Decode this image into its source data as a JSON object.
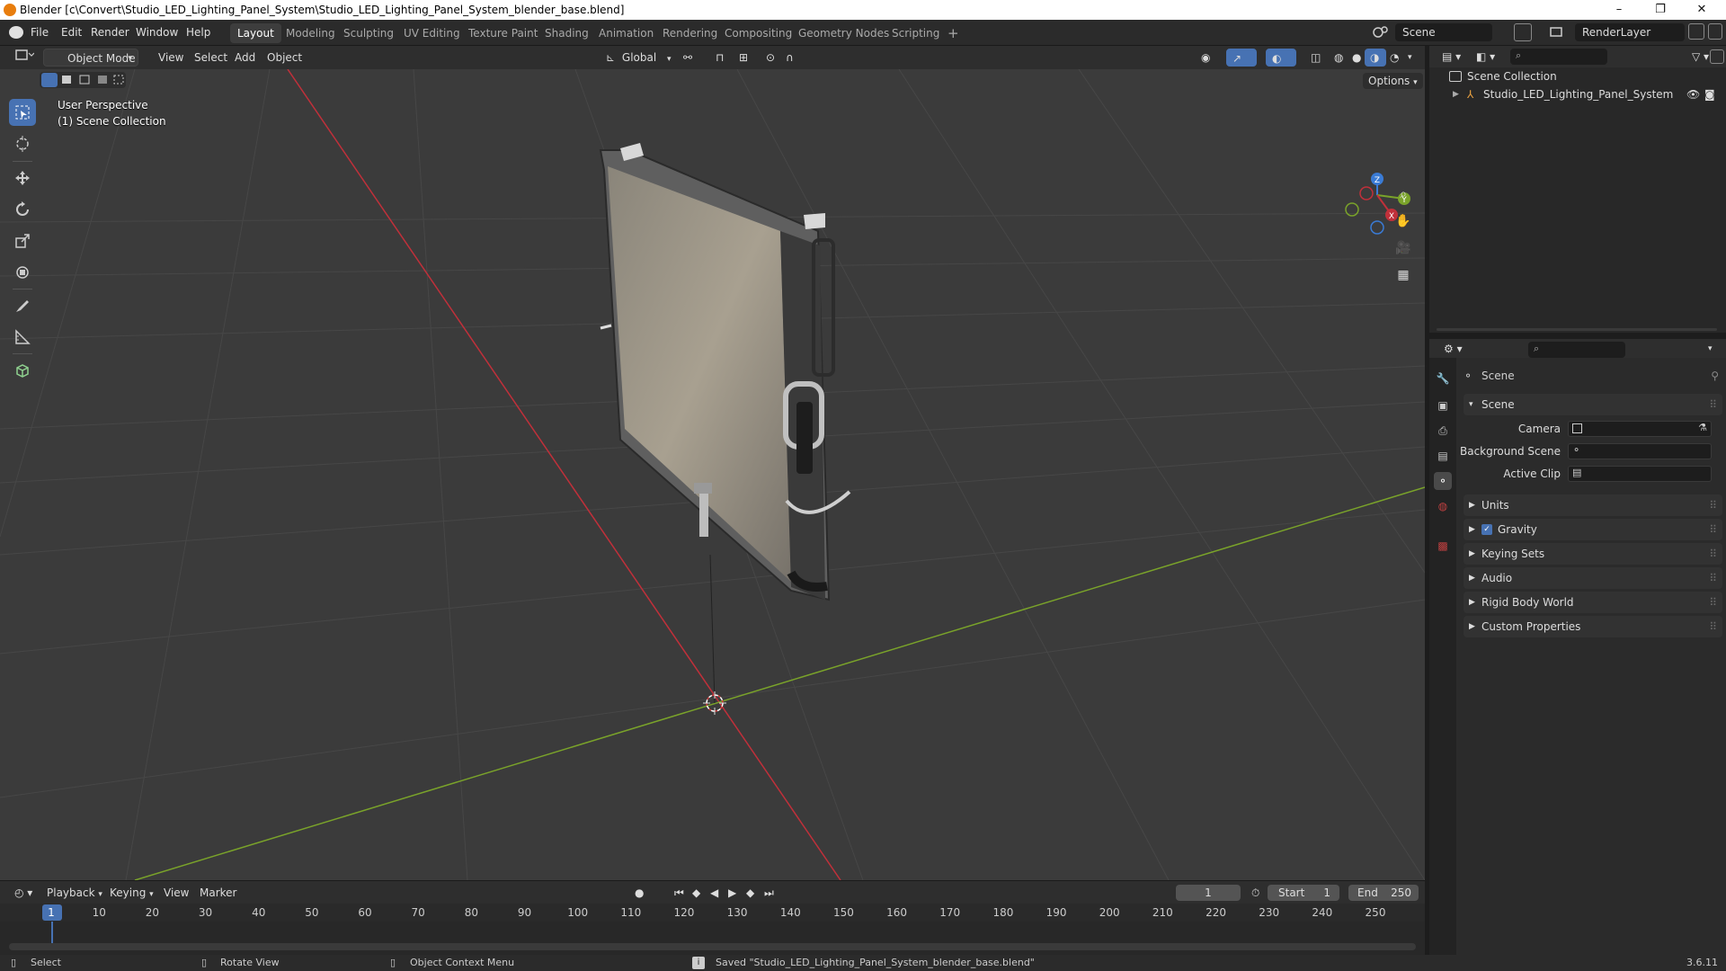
{
  "window": {
    "title": "Blender [c\\Convert\\Studio_LED_Lighting_Panel_System\\Studio_LED_Lighting_Panel_System_blender_base.blend]",
    "minimize": "–",
    "maximize": "❐",
    "close": "✕"
  },
  "menu": {
    "items": [
      "File",
      "Edit",
      "Render",
      "Window",
      "Help"
    ]
  },
  "workspaces": {
    "tabs": [
      "Layout",
      "Modeling",
      "Sculpting",
      "UV Editing",
      "Texture Paint",
      "Shading",
      "Animation",
      "Rendering",
      "Compositing",
      "Geometry Nodes",
      "Scripting"
    ],
    "add": "+",
    "active": "Layout"
  },
  "scene_selector": {
    "scene": "Scene",
    "view_layer": "RenderLayer"
  },
  "viewport_header": {
    "mode": "Object Mode",
    "menus": [
      "View",
      "Select",
      "Add",
      "Object"
    ],
    "transform_orientation": "Global",
    "options": "Options"
  },
  "viewport": {
    "perspective": "User Perspective",
    "collection": "(1) Scene Collection",
    "axis_colors": {
      "x": "#c0303a",
      "y": "#7aa32a",
      "z": "#3a7bd5"
    },
    "gizmo": {
      "x": "X",
      "y": "Y",
      "z": "Z"
    }
  },
  "toolbar": {
    "tools": [
      "select-box-icon",
      "cursor-icon",
      "move-icon",
      "rotate-icon",
      "scale-icon",
      "transform-icon",
      "annotate-icon",
      "measure-icon",
      "add-cube-icon"
    ]
  },
  "timeline": {
    "menus": [
      "Playback",
      "Keying",
      "View",
      "Marker"
    ],
    "current_frame": "1",
    "start_label": "Start",
    "start": "1",
    "end_label": "End",
    "end": "250",
    "ticks": [
      "1",
      "10",
      "20",
      "30",
      "40",
      "50",
      "60",
      "70",
      "80",
      "90",
      "100",
      "110",
      "120",
      "130",
      "140",
      "150",
      "160",
      "170",
      "180",
      "190",
      "200",
      "210",
      "220",
      "230",
      "240",
      "250"
    ]
  },
  "statusbar": {
    "select": "Select",
    "rotate": "Rotate View",
    "context": "Object Context Menu",
    "message": "Saved \"Studio_LED_Lighting_Panel_System_blender_base.blend\"",
    "version": "3.6.11"
  },
  "outliner": {
    "root": "Scene Collection",
    "items": [
      {
        "label": "Studio_LED_Lighting_Panel_System"
      }
    ]
  },
  "properties": {
    "header": "Scene",
    "panel_title": "Scene",
    "fields": [
      {
        "label": "Camera"
      },
      {
        "label": "Background Scene"
      },
      {
        "label": "Active Clip"
      }
    ],
    "panels": [
      "Units",
      "Gravity",
      "Keying Sets",
      "Audio",
      "Rigid Body World",
      "Custom Properties"
    ],
    "gravity_checked": true
  }
}
